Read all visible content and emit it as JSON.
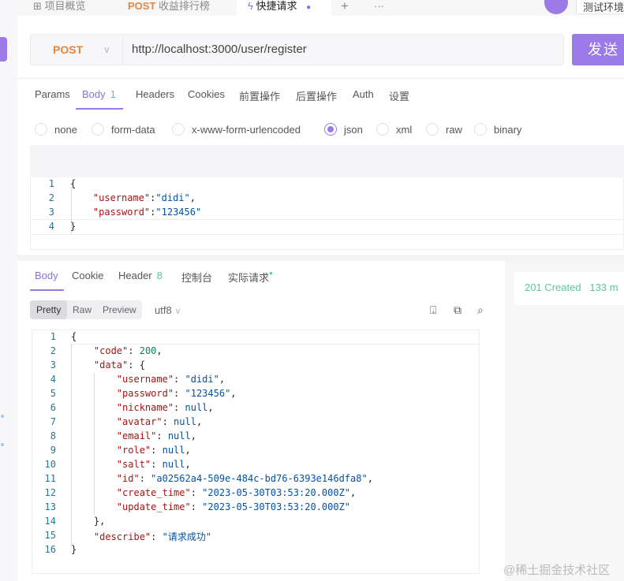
{
  "tabs": [
    {
      "label": "项目概览",
      "icon": "grid-icon"
    },
    {
      "method": "POST",
      "label": "收益排行榜"
    },
    {
      "label": "快捷请求",
      "icon": "lightning-icon",
      "active": true
    }
  ],
  "env": "测试环境-...",
  "request": {
    "method": "POST",
    "url": "http://localhost:3000/user/register",
    "send": "发送"
  },
  "request_tabs": [
    {
      "label": "Params"
    },
    {
      "label": "Body",
      "badge": "1"
    },
    {
      "label": "Headers"
    },
    {
      "label": "Cookies"
    },
    {
      "label": "前置操作"
    },
    {
      "label": "后置操作"
    },
    {
      "label": "Auth"
    },
    {
      "label": "设置"
    }
  ],
  "body_types": [
    "none",
    "form-data",
    "x-www-form-urlencoded",
    "json",
    "xml",
    "raw",
    "binary"
  ],
  "selected_body_type": "json",
  "request_body": [
    [
      [
        "{",
        "p"
      ]
    ],
    [
      [
        "    ",
        ""
      ],
      [
        "\"username\"",
        "k"
      ],
      [
        ":",
        "p"
      ],
      [
        "\"didi\"",
        "s"
      ],
      [
        ",",
        "p"
      ]
    ],
    [
      [
        "    ",
        ""
      ],
      [
        "\"password\"",
        "k"
      ],
      [
        ":",
        "p"
      ],
      [
        "\"123456\"",
        "s"
      ]
    ],
    [
      [
        "}",
        "p"
      ]
    ]
  ],
  "response_tabs": [
    {
      "label": "Body"
    },
    {
      "label": "Cookie"
    },
    {
      "label": "Header",
      "badge": "8"
    },
    {
      "label": "控制台"
    },
    {
      "label": "实际请求"
    }
  ],
  "view_modes": [
    "Pretty",
    "Raw",
    "Preview"
  ],
  "encoding": "utf8",
  "status": {
    "code": "201 Created",
    "time": "133 m"
  },
  "colors": {
    "accent": "#9b7be8",
    "success": "#5cc6a4",
    "post": "#e8833a"
  },
  "response_body": [
    [
      [
        "{",
        "p"
      ]
    ],
    [
      [
        "    ",
        ""
      ],
      [
        "\"code\"",
        "k"
      ],
      [
        ": ",
        "p"
      ],
      [
        "200",
        "n"
      ],
      [
        ",",
        "p"
      ]
    ],
    [
      [
        "    ",
        ""
      ],
      [
        "\"data\"",
        "k"
      ],
      [
        ": {",
        "p"
      ]
    ],
    [
      [
        "        ",
        ""
      ],
      [
        "\"username\"",
        "k"
      ],
      [
        ": ",
        "p"
      ],
      [
        "\"didi\"",
        "s"
      ],
      [
        ",",
        "p"
      ]
    ],
    [
      [
        "        ",
        ""
      ],
      [
        "\"password\"",
        "k"
      ],
      [
        ": ",
        "p"
      ],
      [
        "\"123456\"",
        "s"
      ],
      [
        ",",
        "p"
      ]
    ],
    [
      [
        "        ",
        ""
      ],
      [
        "\"nickname\"",
        "k"
      ],
      [
        ": ",
        "p"
      ],
      [
        "null",
        "nl"
      ],
      [
        ",",
        "p"
      ]
    ],
    [
      [
        "        ",
        ""
      ],
      [
        "\"avatar\"",
        "k"
      ],
      [
        ": ",
        "p"
      ],
      [
        "null",
        "nl"
      ],
      [
        ",",
        "p"
      ]
    ],
    [
      [
        "        ",
        ""
      ],
      [
        "\"email\"",
        "k"
      ],
      [
        ": ",
        "p"
      ],
      [
        "null",
        "nl"
      ],
      [
        ",",
        "p"
      ]
    ],
    [
      [
        "        ",
        ""
      ],
      [
        "\"role\"",
        "k"
      ],
      [
        ": ",
        "p"
      ],
      [
        "null",
        "nl"
      ],
      [
        ",",
        "p"
      ]
    ],
    [
      [
        "        ",
        ""
      ],
      [
        "\"salt\"",
        "k"
      ],
      [
        ": ",
        "p"
      ],
      [
        "null",
        "nl"
      ],
      [
        ",",
        "p"
      ]
    ],
    [
      [
        "        ",
        ""
      ],
      [
        "\"id\"",
        "k"
      ],
      [
        ": ",
        "p"
      ],
      [
        "\"a02562a4-509e-484c-bd76-6393e146dfa8\"",
        "s"
      ],
      [
        ",",
        "p"
      ]
    ],
    [
      [
        "        ",
        ""
      ],
      [
        "\"create_time\"",
        "k"
      ],
      [
        ": ",
        "p"
      ],
      [
        "\"2023-05-30T03:53:20.000Z\"",
        "s"
      ],
      [
        ",",
        "p"
      ]
    ],
    [
      [
        "        ",
        ""
      ],
      [
        "\"update_time\"",
        "k"
      ],
      [
        ": ",
        "p"
      ],
      [
        "\"2023-05-30T03:53:20.000Z\"",
        "s"
      ]
    ],
    [
      [
        "    ",
        ""
      ],
      [
        "},",
        "p"
      ]
    ],
    [
      [
        "    ",
        ""
      ],
      [
        "\"describe\"",
        "k"
      ],
      [
        ": ",
        "p"
      ],
      [
        "\"请求成功\"",
        "s"
      ]
    ],
    [
      [
        "}",
        "p"
      ]
    ]
  ],
  "watermark": "@稀土掘金技术社区"
}
